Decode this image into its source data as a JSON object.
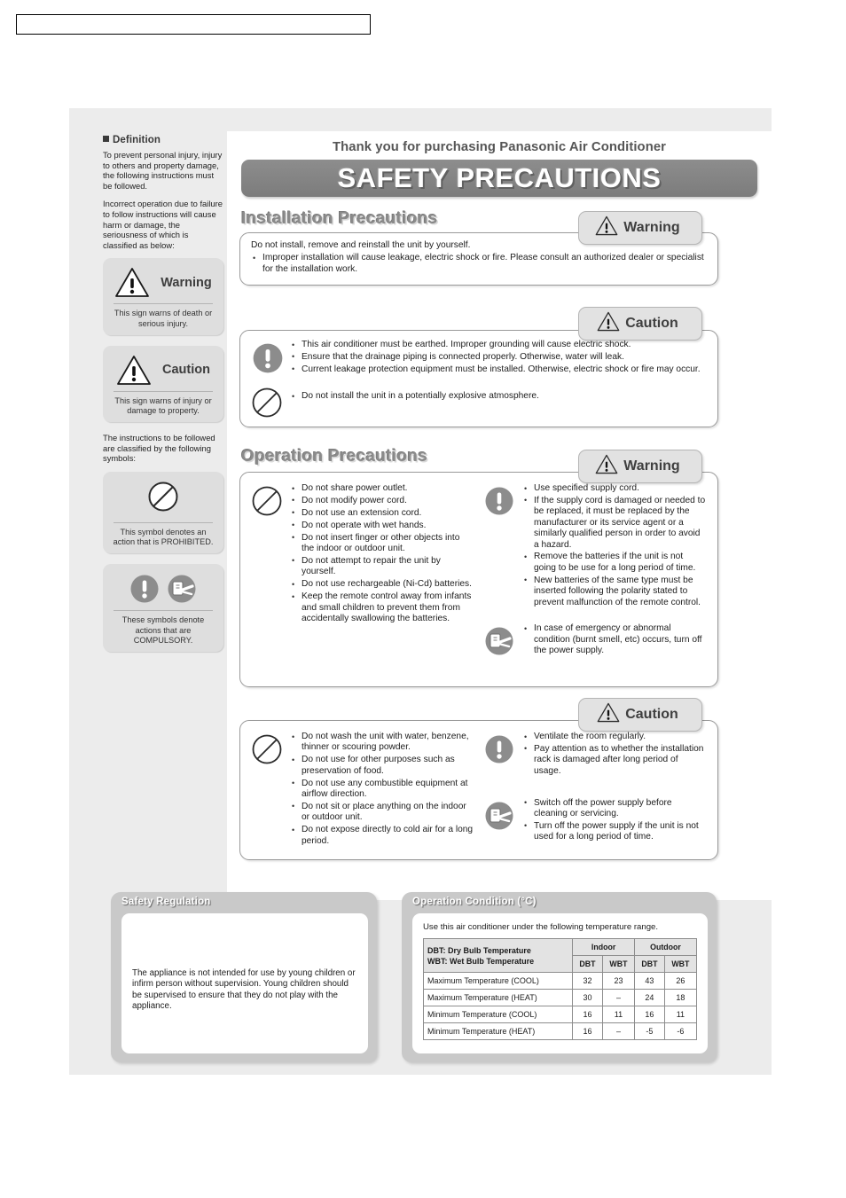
{
  "top_field": {
    "value": ""
  },
  "sidebar": {
    "heading": "Definition",
    "paragraphs": [
      "To prevent personal injury, injury to others and property damage, the following instructions must be followed.",
      "Incorrect operation due to failure to follow instructions will cause harm or damage, the seriousness of which is classified as below:"
    ],
    "warning_box": {
      "icon": "warning-triangle-icon",
      "label": "Warning",
      "caption": "This sign warns of death or serious injury."
    },
    "caution_box": {
      "icon": "warning-triangle-icon",
      "label": "Caution",
      "caption": "This sign warns of injury or damage to property."
    },
    "symbols_intro": "The instructions to be followed are classified by the following symbols:",
    "prohibited_box": {
      "icon": "prohibited-icon",
      "caption": "This symbol denotes an action that is PROHIBITED."
    },
    "compulsory_box": {
      "icons": [
        "exclamation-circle-icon",
        "unplug-icon"
      ],
      "caption": "These symbols denote actions that are COMPULSORY."
    }
  },
  "header": {
    "thanks": "Thank you for purchasing Panasonic Air Conditioner",
    "title": "SAFETY PRECAUTIONS"
  },
  "sections": {
    "installation": {
      "heading": "Installation Precautions",
      "warning": {
        "badge": "Warning",
        "badge_icon": "warning-triangle-icon",
        "lead": "Do not install, remove and reinstall the unit by yourself.",
        "items": [
          "Improper installation will cause leakage, electric shock or fire. Please consult an authorized dealer or specialist for the installation work."
        ]
      },
      "caution": {
        "badge": "Caution",
        "badge_icon": "warning-triangle-icon",
        "compulsory_icon": "exclamation-circle-icon",
        "compulsory_items": [
          "This air conditioner must be earthed. Improper grounding will cause electric shock.",
          "Ensure that the drainage piping is connected properly. Otherwise, water will leak.",
          "Current leakage protection equipment must be installed. Otherwise, electric shock or fire may occur."
        ],
        "prohibited_icon": "prohibited-icon",
        "prohibited_items": [
          "Do not install the unit in a potentially explosive atmosphere."
        ]
      }
    },
    "operation": {
      "heading": "Operation Precautions",
      "warning": {
        "badge": "Warning",
        "badge_icon": "warning-triangle-icon",
        "left_icon": "prohibited-icon",
        "left_items": [
          "Do not share power outlet.",
          "Do not modify power cord.",
          "Do not use an extension cord.",
          "Do not operate with wet hands.",
          "Do not insert finger or other objects into the indoor or outdoor unit.",
          "Do not attempt to repair the unit by yourself.",
          "Do not use rechargeable (Ni-Cd) batteries.",
          "Keep the remote control away from infants and small children to prevent them from accidentally swallowing the batteries."
        ],
        "right_icon": "exclamation-circle-icon",
        "right_items": [
          "Use specified supply cord.",
          "If the supply cord is damaged or needed to be replaced, it must be replaced by the manufacturer or its service agent or a similarly qualified person in order to avoid a hazard.",
          "Remove the batteries if the unit is not going to be use for a long period of time.",
          "New batteries of the same type must be inserted following the polarity stated to prevent malfunction of the remote control."
        ],
        "unplug_icon": "unplug-icon",
        "unplug_items": [
          "In case of emergency or abnormal condition (burnt smell, etc) occurs, turn off the power supply."
        ]
      },
      "caution": {
        "badge": "Caution",
        "badge_icon": "warning-triangle-icon",
        "left_icon": "prohibited-icon",
        "left_items": [
          "Do not wash the unit with water, benzene, thinner or scouring powder.",
          "Do not use for other purposes such as preservation of food.",
          "Do not use any combustible equipment at airflow direction.",
          "Do not sit or place anything on the indoor or outdoor unit.",
          "Do not expose directly to cold air for a long period."
        ],
        "right_icon": "exclamation-circle-icon",
        "right_items": [
          "Ventilate the room regularly.",
          "Pay attention as to whether the installation rack is damaged after long period of usage."
        ],
        "unplug_icon": "unplug-icon",
        "unplug_items": [
          "Switch off the power supply before cleaning or servicing.",
          "Turn off the power supply if the unit is not used for a long period of time."
        ]
      }
    }
  },
  "safety_regulation": {
    "heading": "Safety Regulation",
    "text": "The appliance is not intended for use by young children or infirm person without supervision. Young children should be supervised to ensure that they do not play with the appliance."
  },
  "operation_condition": {
    "heading": "Operation Condition (°C)",
    "note": "Use this air conditioner under the following temperature range.",
    "table": {
      "definition_lines": [
        "DBT: Dry Bulb Temperature",
        "WBT: Wet Bulb Temperature"
      ],
      "groups": [
        "Indoor",
        "Outdoor"
      ],
      "subheaders": [
        "DBT",
        "WBT",
        "DBT",
        "WBT"
      ],
      "rows": [
        {
          "label": "Maximum Temperature (COOL)",
          "values": [
            "32",
            "23",
            "43",
            "26"
          ]
        },
        {
          "label": "Maximum Temperature (HEAT)",
          "values": [
            "30",
            "–",
            "24",
            "18"
          ]
        },
        {
          "label": "Minimum Temperature (COOL)",
          "values": [
            "16",
            "11",
            "16",
            "11"
          ]
        },
        {
          "label": "Minimum Temperature (HEAT)",
          "values": [
            "16",
            "–",
            "-5",
            "-6"
          ]
        }
      ]
    }
  },
  "colors": {
    "page_bg": "#ececec",
    "title_bar": "#7c7c7c",
    "badge_bg": "#e2e2e2",
    "icon_gray": "#8c8c8c",
    "bottom_box": "#c9c9c9"
  }
}
